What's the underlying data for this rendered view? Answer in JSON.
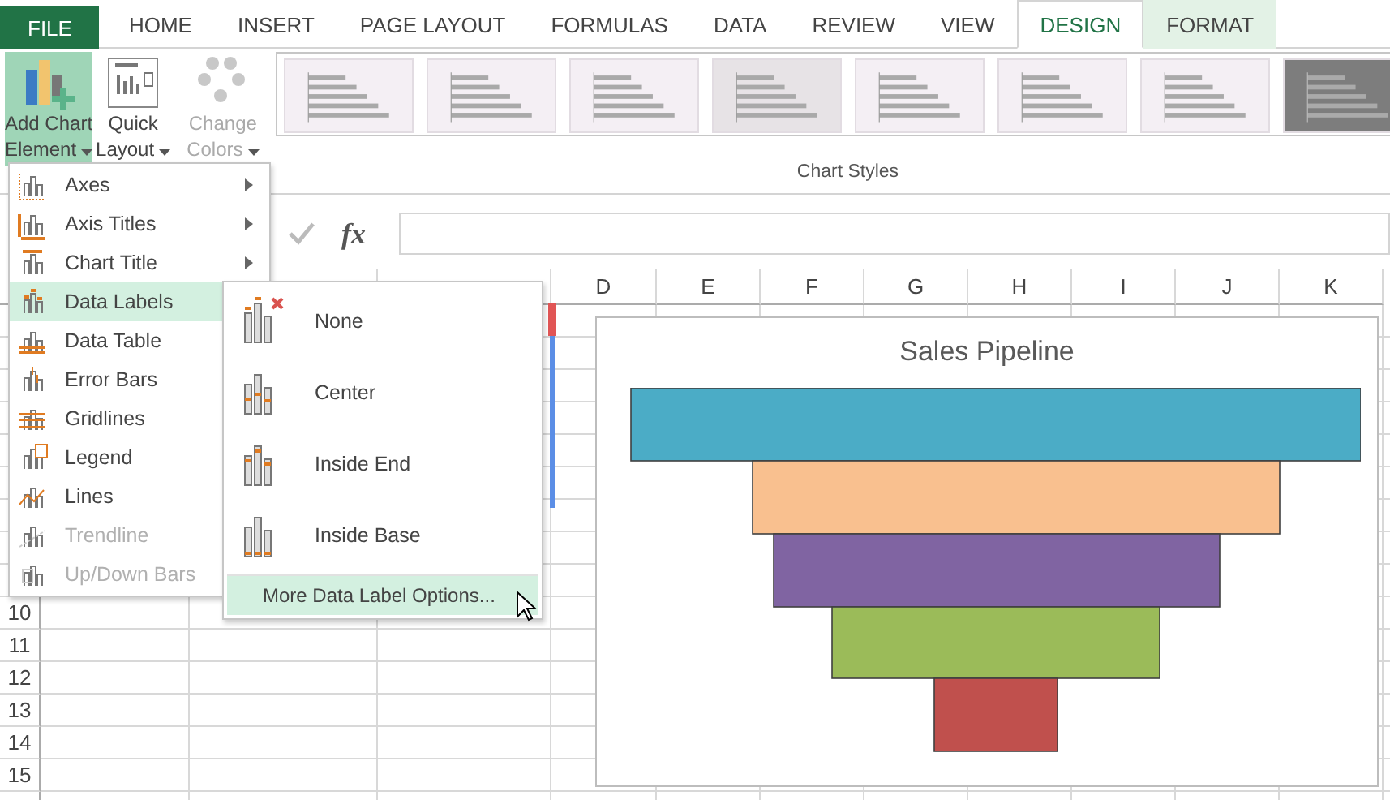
{
  "ribbon_tabs": [
    {
      "label": "FILE",
      "kind": "file",
      "selected": false
    },
    {
      "label": "HOME",
      "kind": "tab",
      "selected": false
    },
    {
      "label": "INSERT",
      "kind": "tab",
      "selected": false
    },
    {
      "label": "PAGE LAYOUT",
      "kind": "tab",
      "selected": false
    },
    {
      "label": "FORMULAS",
      "kind": "tab",
      "selected": false
    },
    {
      "label": "DATA",
      "kind": "tab",
      "selected": false
    },
    {
      "label": "REVIEW",
      "kind": "tab",
      "selected": false
    },
    {
      "label": "VIEW",
      "kind": "tab",
      "selected": false
    },
    {
      "label": "DESIGN",
      "kind": "context",
      "selected": true
    },
    {
      "label": "FORMAT",
      "kind": "context",
      "selected": false
    }
  ],
  "ribbon": {
    "buttons": [
      {
        "kind": "add-element",
        "lines": [
          "Add Chart",
          "Element"
        ],
        "active": true,
        "disabled": false
      },
      {
        "kind": "quick-layout",
        "lines": [
          "Quick",
          "Layout"
        ],
        "active": false,
        "disabled": false
      },
      {
        "kind": "change-colors",
        "lines": [
          "Change",
          "Colors"
        ],
        "active": false,
        "disabled": true
      }
    ],
    "chart_styles": {
      "label": "Chart Styles",
      "thumbnails": [
        {
          "kind": "plain"
        },
        {
          "kind": "plain"
        },
        {
          "kind": "plain"
        },
        {
          "kind": "shaded"
        },
        {
          "kind": "plain"
        },
        {
          "kind": "plain"
        },
        {
          "kind": "plain"
        },
        {
          "kind": "dark"
        }
      ]
    }
  },
  "formula_bar": {
    "function_label": "fx"
  },
  "sheet": {
    "column_headers": [
      "D",
      "E",
      "F",
      "G",
      "H",
      "I",
      "J",
      "K"
    ],
    "row_headers": [
      "10",
      "11",
      "12",
      "13",
      "14",
      "15"
    ]
  },
  "chart": {
    "title": "Sales Pipeline"
  },
  "menu": {
    "items": [
      {
        "label": "Axes",
        "selected": false,
        "disabled": false,
        "kind": "axes"
      },
      {
        "label": "Axis Titles",
        "selected": false,
        "disabled": false,
        "kind": "axis-titles"
      },
      {
        "label": "Chart Title",
        "selected": false,
        "disabled": false,
        "kind": "chart-title"
      },
      {
        "label": "Data Labels",
        "selected": true,
        "disabled": false,
        "kind": "data-labels"
      },
      {
        "label": "Data Table",
        "selected": false,
        "disabled": false,
        "kind": "data-table"
      },
      {
        "label": "Error Bars",
        "selected": false,
        "disabled": false,
        "kind": "error-bars"
      },
      {
        "label": "Gridlines",
        "selected": false,
        "disabled": false,
        "kind": "gridlines"
      },
      {
        "label": "Legend",
        "selected": false,
        "disabled": false,
        "kind": "legend"
      },
      {
        "label": "Lines",
        "selected": false,
        "disabled": false,
        "kind": "lines"
      },
      {
        "label": "Trendline",
        "selected": false,
        "disabled": true,
        "kind": "trendline"
      },
      {
        "label": "Up/Down Bars",
        "selected": false,
        "disabled": true,
        "kind": "updown"
      }
    ]
  },
  "submenu": {
    "items": [
      {
        "label": "None",
        "kind": "none"
      },
      {
        "label": "Center",
        "kind": "center"
      },
      {
        "label": "Inside End",
        "kind": "inside-end"
      },
      {
        "label": "Inside Base",
        "kind": "inside-base"
      }
    ],
    "more_option": {
      "label": "More Data Label Options...",
      "selected": true
    }
  }
}
